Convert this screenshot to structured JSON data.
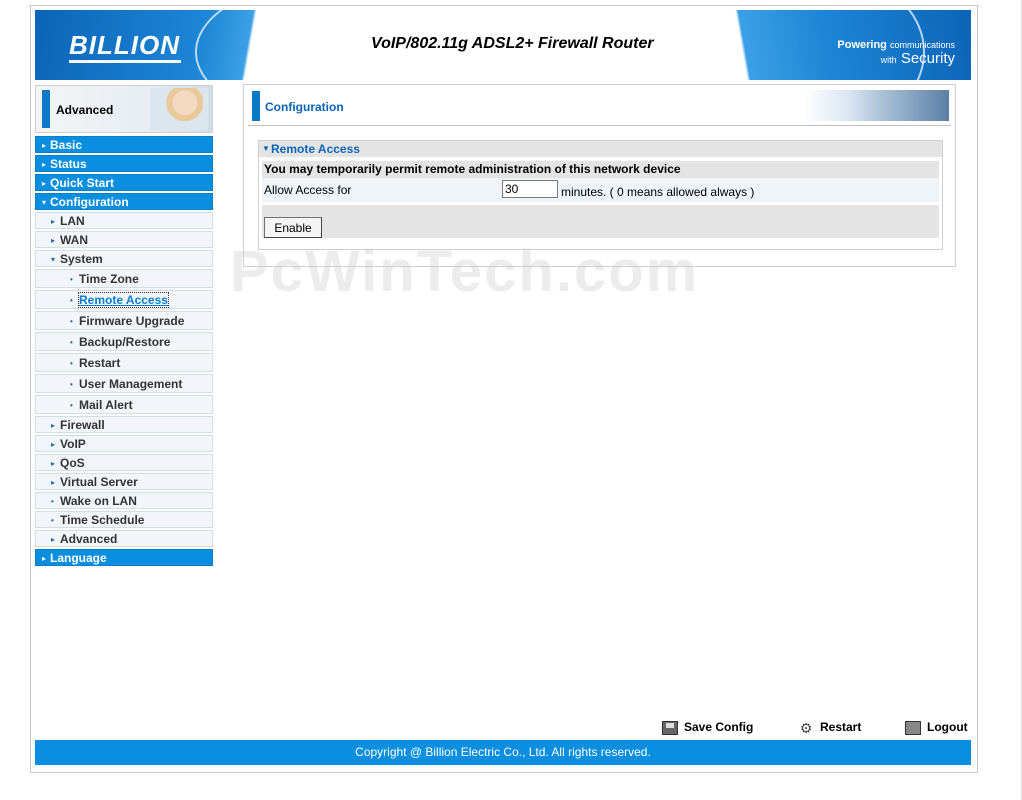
{
  "header": {
    "logo": "BILLION",
    "title": "VoIP/802.11g ADSL2+ Firewall Router",
    "tagline_powering": "Powering",
    "tagline_communications": "communications",
    "tagline_with": "with",
    "tagline_security": "Security"
  },
  "sidebar": {
    "banner_label": "Advanced",
    "items": [
      {
        "label": "Basic",
        "level": "top",
        "arrow": "▸"
      },
      {
        "label": "Status",
        "level": "top",
        "arrow": "▸"
      },
      {
        "label": "Quick Start",
        "level": "top",
        "arrow": "▸"
      },
      {
        "label": "Configuration",
        "level": "top",
        "arrow": "▾"
      },
      {
        "label": "LAN",
        "level": "sub",
        "arrow": "▸"
      },
      {
        "label": "WAN",
        "level": "sub",
        "arrow": "▸"
      },
      {
        "label": "System",
        "level": "sub",
        "arrow": "▾"
      },
      {
        "label": "Time Zone",
        "level": "sub2",
        "arrow": "•"
      },
      {
        "label": "Remote Access",
        "level": "sub2",
        "arrow": "•",
        "selected": true
      },
      {
        "label": "Firmware Upgrade",
        "level": "sub2",
        "arrow": "•"
      },
      {
        "label": "Backup/Restore",
        "level": "sub2",
        "arrow": "•"
      },
      {
        "label": "Restart",
        "level": "sub2",
        "arrow": "•"
      },
      {
        "label": "User Management",
        "level": "sub2",
        "arrow": "•"
      },
      {
        "label": "Mail Alert",
        "level": "sub2",
        "arrow": "•"
      },
      {
        "label": "Firewall",
        "level": "sub",
        "arrow": "▸"
      },
      {
        "label": "VoIP",
        "level": "sub",
        "arrow": "▸"
      },
      {
        "label": "QoS",
        "level": "sub",
        "arrow": "▸"
      },
      {
        "label": "Virtual Server",
        "level": "sub",
        "arrow": "▸"
      },
      {
        "label": "Wake on LAN",
        "level": "sub",
        "arrow": "•"
      },
      {
        "label": "Time Schedule",
        "level": "sub",
        "arrow": "•"
      },
      {
        "label": "Advanced",
        "level": "sub",
        "arrow": "▸"
      },
      {
        "label": "Language",
        "level": "top",
        "arrow": "▸"
      }
    ]
  },
  "main": {
    "title": "Configuration",
    "section_title": "Remote Access",
    "description": "You may temporarily permit remote administration of this network device",
    "allow_label": "Allow Access for",
    "minutes_value": "30",
    "minutes_hint": "minutes. ( 0 means allowed always )",
    "enable_button": "Enable"
  },
  "watermark": "PcWinTech.com",
  "footer": {
    "save_config": "Save Config",
    "restart": "Restart",
    "logout": "Logout",
    "copyright": "Copyright @ Billion Electric Co., Ltd. All rights reserved."
  },
  "colors": {
    "accent": "#0a8ee0",
    "title_blue": "#0b64b8",
    "section_gray": "#e4e4e4"
  }
}
